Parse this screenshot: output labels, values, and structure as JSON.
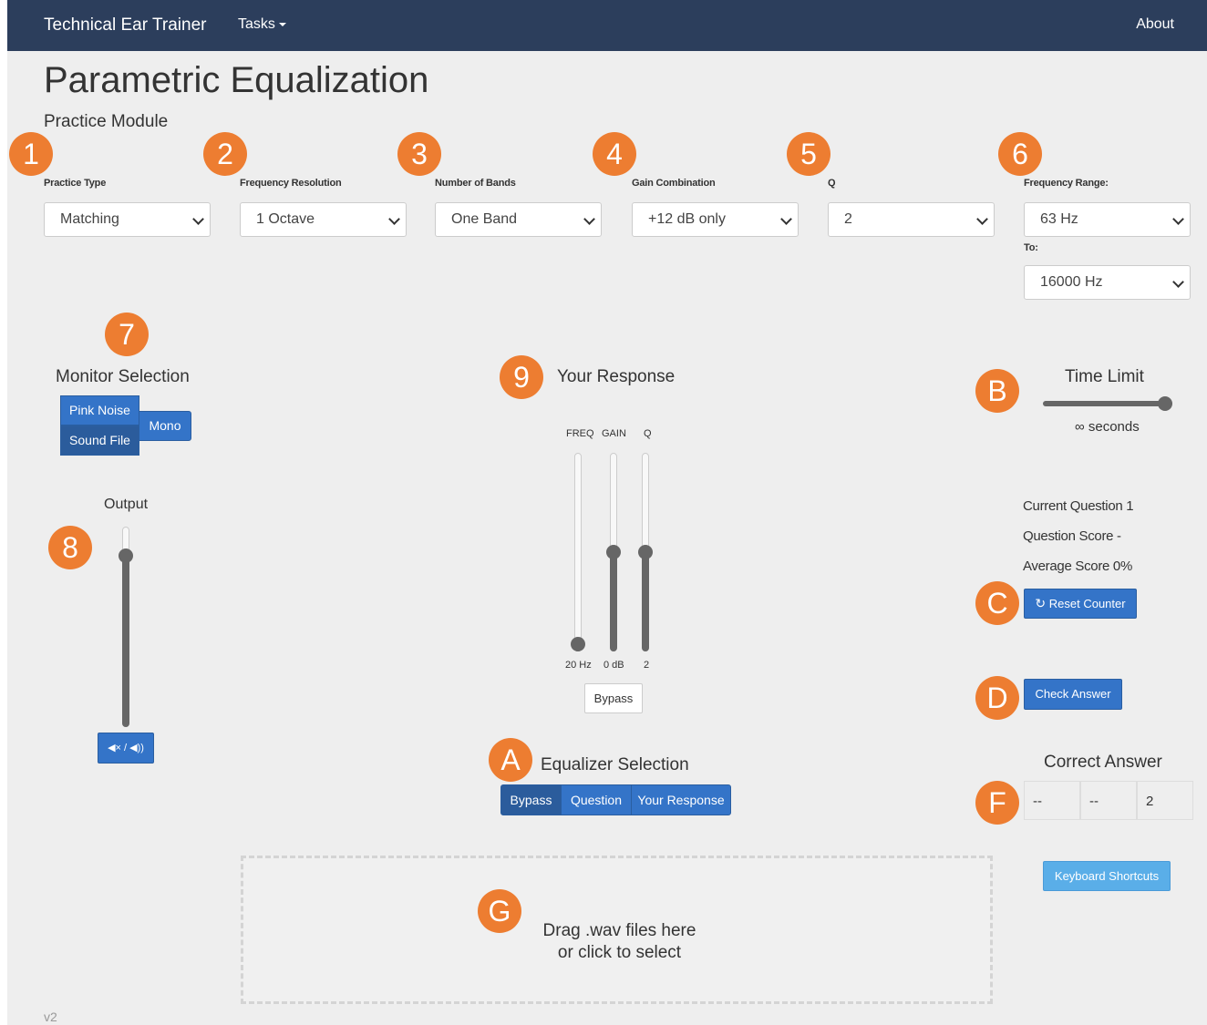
{
  "navbar": {
    "brand": "Technical Ear Trainer",
    "tasks_label": "Tasks",
    "about_label": "About"
  },
  "page": {
    "title": "Parametric Equalization",
    "subtitle": "Practice Module",
    "version": "v2"
  },
  "controls": [
    {
      "badge": "1",
      "label": "Practice Type",
      "value": "Matching"
    },
    {
      "badge": "2",
      "label": "Frequency Resolution",
      "value": "1 Octave"
    },
    {
      "badge": "3",
      "label": "Number of Bands",
      "value": "One Band"
    },
    {
      "badge": "4",
      "label": "Gain Combination",
      "value": "+12 dB only"
    },
    {
      "badge": "5",
      "label": "Q",
      "value": "2"
    },
    {
      "badge": "6",
      "label": "Frequency Range:",
      "value": "63 Hz",
      "to_label": "To:",
      "to_value": "16000 Hz"
    }
  ],
  "monitor": {
    "badge": "7",
    "title": "Monitor Selection",
    "pink_noise": "Pink Noise",
    "sound_file": "Sound File",
    "mono": "Mono"
  },
  "output": {
    "badge": "8",
    "title": "Output",
    "level": 0.88,
    "mute_label": "◀× / ◀))"
  },
  "response": {
    "badge": "9",
    "title": "Your Response",
    "sliders": [
      {
        "label": "FREQ",
        "value": "20 Hz",
        "level": 0.0
      },
      {
        "label": "GAIN",
        "value": "0 dB",
        "level": 0.5
      },
      {
        "label": "Q",
        "value": "2",
        "level": 0.5
      }
    ],
    "bypass_label": "Bypass"
  },
  "equalizer": {
    "badge": "A",
    "title": "Equalizer Selection",
    "options": [
      "Bypass",
      "Question",
      "Your Response"
    ],
    "selected": "Bypass"
  },
  "time_limit": {
    "badge": "B",
    "title": "Time Limit",
    "value": "∞ seconds",
    "level": 1.0
  },
  "stats": {
    "current_question": "Current Question 1",
    "question_score": "Question Score -",
    "average_score": "Average Score 0%"
  },
  "reset": {
    "badge": "C",
    "label": "Reset Counter",
    "icon": "refresh-icon"
  },
  "check": {
    "badge": "D",
    "label": "Check Answer"
  },
  "answer": {
    "badge": "F",
    "title": "Correct Answer",
    "cells": [
      "--",
      "--",
      "2"
    ]
  },
  "shortcuts": {
    "label": "Keyboard Shortcuts"
  },
  "dropzone": {
    "badge": "G",
    "line1": "Drag .wav files here",
    "line2": "or click to select"
  },
  "colors": {
    "navbar": "#2c3e5c",
    "badge": "#ed7d31",
    "primary": "#3474c8",
    "background": "#eeeeee"
  }
}
